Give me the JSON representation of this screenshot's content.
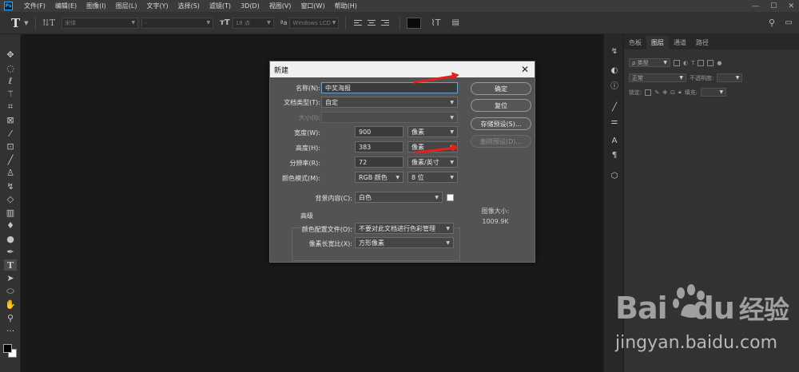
{
  "app": {
    "logo_text": "Ps"
  },
  "menubar": {
    "items": [
      "文件(F)",
      "编辑(E)",
      "图像(I)",
      "图层(L)",
      "文字(Y)",
      "选择(S)",
      "滤镜(T)",
      "3D(D)",
      "视图(V)",
      "窗口(W)",
      "帮助(H)"
    ],
    "window_buttons": [
      "—",
      "☐",
      "✕"
    ]
  },
  "options_bar": {
    "font_family": "宋体",
    "font_style": "-",
    "font_size": "18 点",
    "antialias_label": "ªa",
    "antialias": "Windows LCD",
    "text_color": "#0a0a0a"
  },
  "right_panel": {
    "tabs": [
      "色板",
      "图层",
      "通道",
      "路径"
    ],
    "active_tab": "图层",
    "filter_kind": "ρ 类型",
    "blend_mode": "正常",
    "opacity_label": "不透明度:",
    "lock_label": "锁定:",
    "fill_label": "填充:"
  },
  "dialog": {
    "title": "新建",
    "name_label": "名称(N):",
    "name_value": "中奖海报",
    "preset_label": "文档类型(T):",
    "preset_value": "自定",
    "size_label": "大小(I):",
    "width_label": "宽度(W):",
    "width_value": "900",
    "width_unit": "像素",
    "height_label": "高度(H):",
    "height_value": "383",
    "height_unit": "像素",
    "resolution_label": "分辨率(R):",
    "resolution_value": "72",
    "resolution_unit": "像素/英寸",
    "color_mode_label": "颜色模式(M):",
    "color_mode_value": "RGB 颜色",
    "bit_depth": "8 位",
    "background_label": "背景内容(C):",
    "background_value": "白色",
    "advanced_label": "高级",
    "color_profile_label": "颜色配置文件(O):",
    "color_profile_value": "不要对此文档进行色彩管理",
    "pixel_aspect_label": "像素长宽比(X):",
    "pixel_aspect_value": "方形像素",
    "ok_button": "确定",
    "reset_button": "复位",
    "save_preset_button": "存储预设(S)...",
    "delete_preset_button": "删除预设(D)...",
    "image_size_label": "图像大小:",
    "image_size_value": "1009.9K"
  },
  "watermark": {
    "brand": "Bai",
    "brand_suffix": "du",
    "brand_cn": "经验",
    "url": "jingyan.baidu.com"
  },
  "colors": {
    "annotation_arrow": "#e5201d",
    "accent_blue": "#31a8ff"
  }
}
